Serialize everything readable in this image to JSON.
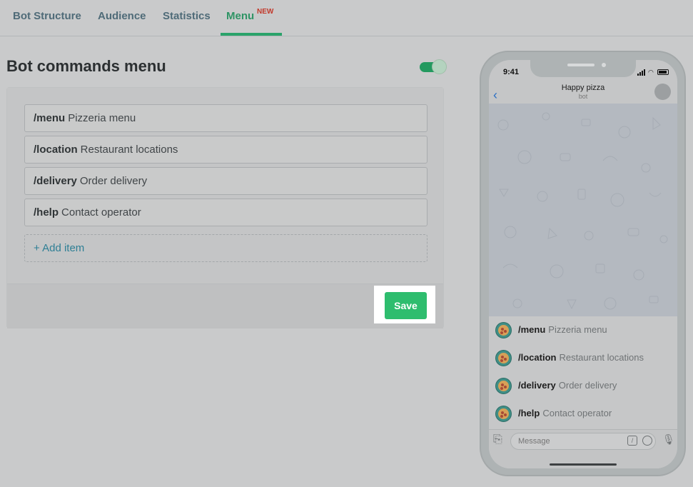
{
  "tabs": [
    {
      "label": "Bot Structure"
    },
    {
      "label": "Audience"
    },
    {
      "label": "Statistics"
    },
    {
      "label": "Menu",
      "badge": "NEW",
      "active": true
    }
  ],
  "section": {
    "title": "Bot commands menu",
    "toggle_enabled": true
  },
  "commands": [
    {
      "command": "/menu",
      "description": "Pizzeria menu"
    },
    {
      "command": "/location",
      "description": "Restaurant locations"
    },
    {
      "command": "/delivery",
      "description": "Order delivery"
    },
    {
      "command": "/help",
      "description": "Contact operator"
    }
  ],
  "add_item_label": "+ Add item",
  "save_label": "Save",
  "phone": {
    "time": "9:41",
    "bot_name": "Happy pizza",
    "bot_subtitle": "bot",
    "message_placeholder": "Message",
    "icons": [
      "back-chevron-icon",
      "paperclip-icon",
      "slash-command-icon",
      "sticker-icon",
      "microphone-icon"
    ]
  },
  "colors": {
    "accent_green": "#2ebd6e",
    "active_tab": "#2e9465",
    "badge_red": "#c2392b",
    "link_teal": "#2e7f95"
  }
}
